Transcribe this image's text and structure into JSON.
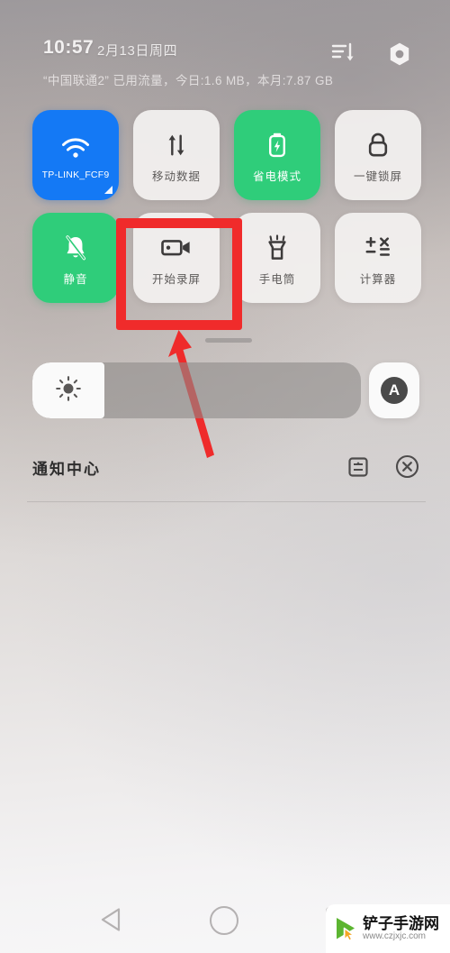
{
  "status_bar": {
    "time": "10:57",
    "date": "2月13日周四",
    "data_usage": "“中国联通2” 已用流量，今日:1.6 MB，本月:7.87 GB",
    "sort_icon": "sort-descending-icon",
    "gear_icon": "hex-settings-icon"
  },
  "quick_settings": {
    "tiles": [
      {
        "label": "TP-LINK_FCF9",
        "icon": "wifi-icon",
        "state": "on-blue",
        "expandable": true
      },
      {
        "label": "移动数据",
        "icon": "mobile-data-icon",
        "state": "off"
      },
      {
        "label": "省电模式",
        "icon": "battery-saver-icon",
        "state": "on-green"
      },
      {
        "label": "一键锁屏",
        "icon": "lock-icon",
        "state": "off"
      },
      {
        "label": "静音",
        "icon": "bell-mute-icon",
        "state": "on-green"
      },
      {
        "label": "开始录屏",
        "icon": "screen-record-icon",
        "state": "off",
        "highlighted": true
      },
      {
        "label": "手电筒",
        "icon": "flashlight-icon",
        "state": "off"
      },
      {
        "label": "计算器",
        "icon": "calculator-icon",
        "state": "off"
      }
    ]
  },
  "brightness": {
    "level_percent": 22,
    "sun_icon": "brightness-sun-icon",
    "auto_label": "A"
  },
  "notification_center": {
    "title": "通知中心",
    "settings_icon": "notification-settings-icon",
    "clear_icon": "clear-all-icon"
  },
  "annotation": {
    "box_color": "#f02b2b",
    "arrow_color": "#ef2b2b",
    "target": "开始录屏"
  },
  "nav_bar": {
    "back_icon": "back-triangle-icon",
    "home_icon": "home-circle-icon",
    "recent_icon": "recent-apps-icon"
  },
  "watermark": {
    "site_name": "铲子手游网",
    "url": "www.czjxjc.com",
    "logo_icon": "play-cursor-logo-icon",
    "logo_color": "#5cb531"
  }
}
